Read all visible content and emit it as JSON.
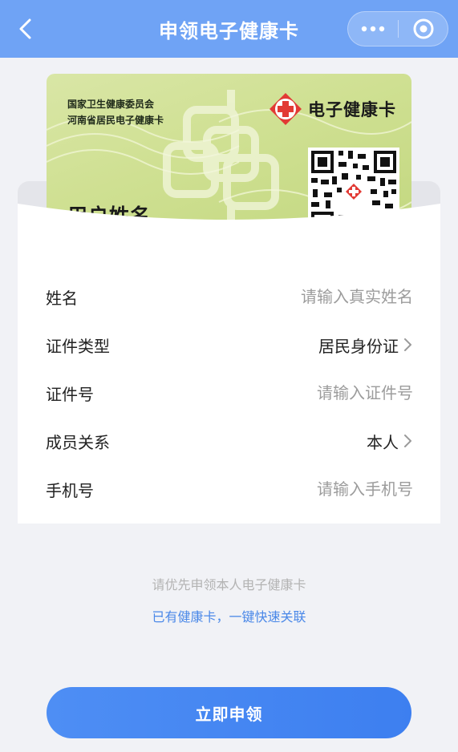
{
  "nav": {
    "title": "申领电子健康卡",
    "bar_color": "#6fa3f5"
  },
  "card": {
    "issuer_line1": "国家卫生健康委员会",
    "issuer_line2": "河南省居民电子健康卡",
    "logo_text": "电子健康卡",
    "user_name": "用户姓名",
    "accent_color": "#e23a34"
  },
  "form": {
    "name": {
      "label": "姓名",
      "placeholder": "请输入真实姓名"
    },
    "id_type": {
      "label": "证件类型",
      "value": "居民身份证"
    },
    "id_number": {
      "label": "证件号",
      "placeholder": "请输入证件号"
    },
    "relation": {
      "label": "成员关系",
      "value": "本人"
    },
    "phone": {
      "label": "手机号",
      "placeholder": "请输入手机号"
    }
  },
  "hint": "请优先申领本人电子健康卡",
  "link_text": "已有健康卡，一键快速关联",
  "apply_button": "立即申领",
  "colors": {
    "primary": "#4e8ef4",
    "link": "#4a88e8"
  }
}
